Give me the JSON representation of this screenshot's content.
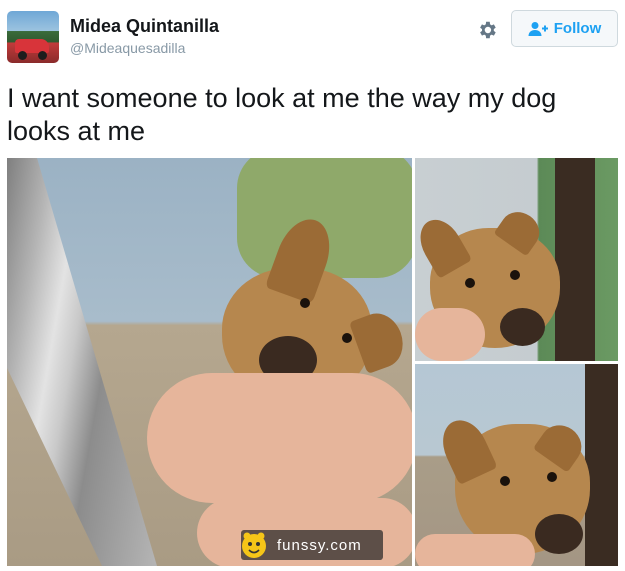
{
  "author": {
    "name": "Midea Quintanilla",
    "handle": "@Mideaquesadilla"
  },
  "actions": {
    "follow_label": "Follow",
    "settings_icon": "gear-icon",
    "follow_icon": "add-user-icon"
  },
  "tweet": {
    "text": "I want someone to look at me the way my dog looks at me"
  },
  "watermark": {
    "text": "funssy.com"
  },
  "colors": {
    "accent": "#1da1f2",
    "name": "#14171a",
    "handle": "#8899a6"
  }
}
